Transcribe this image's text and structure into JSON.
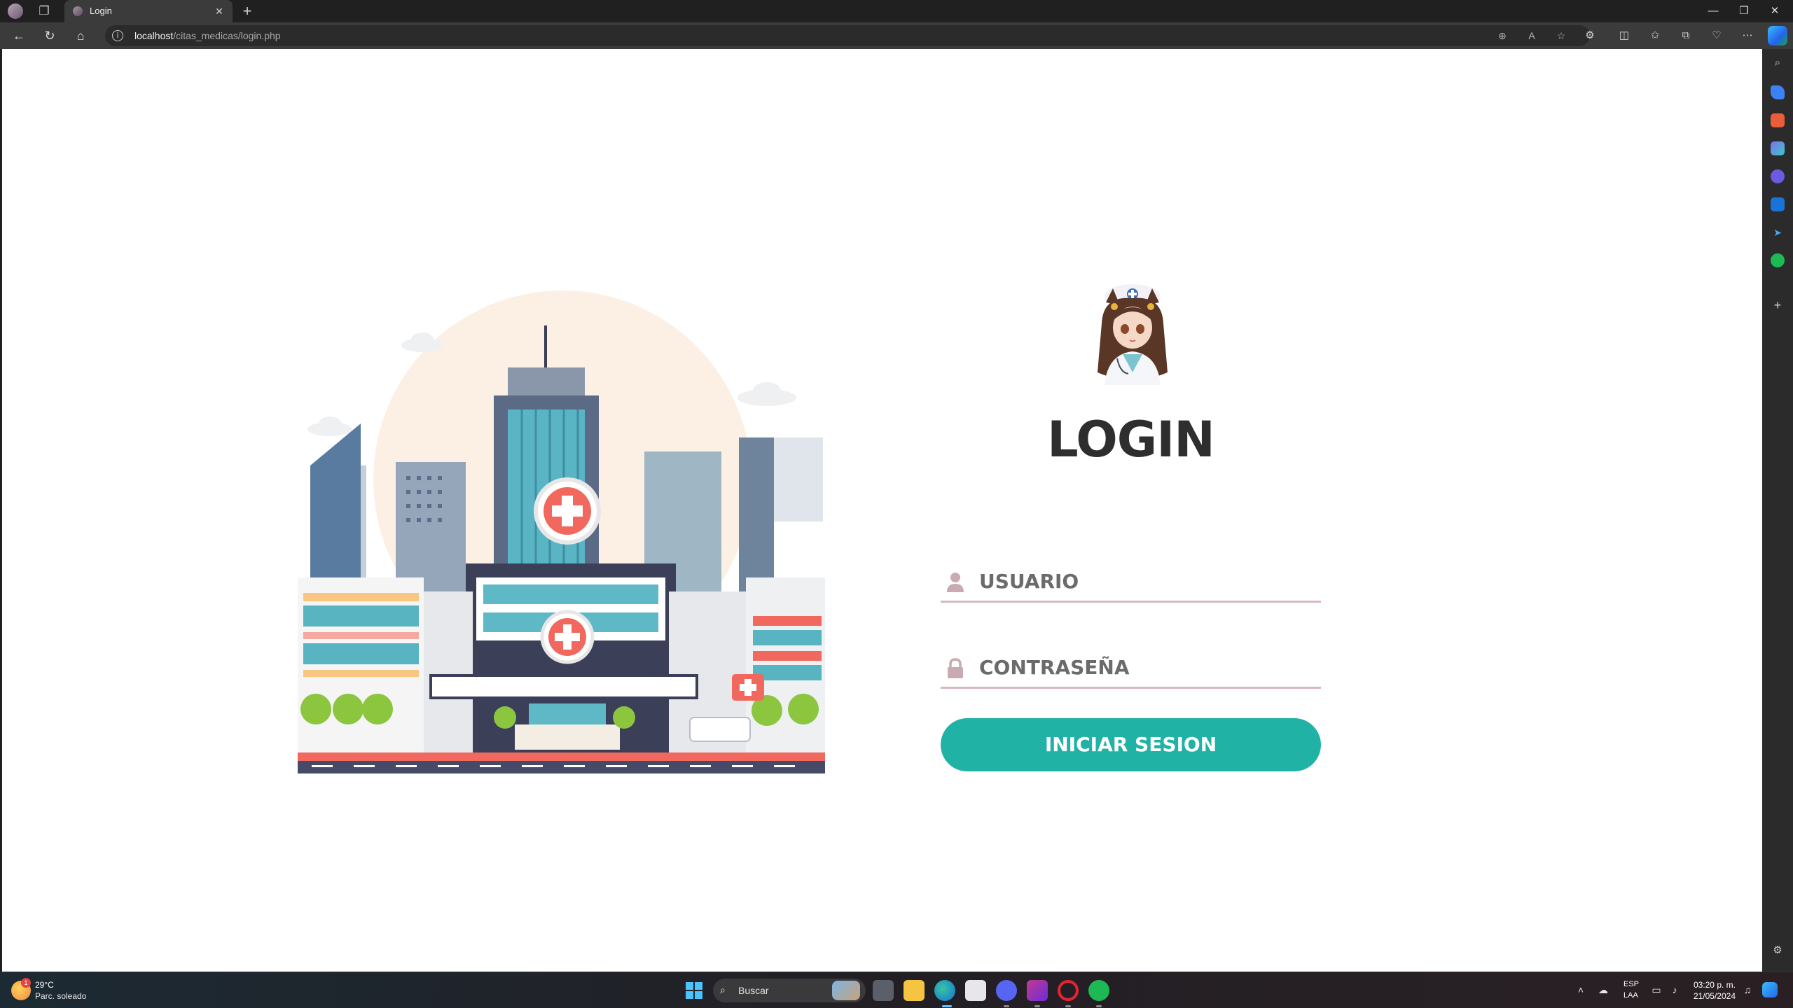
{
  "browser": {
    "tab_title": "Login",
    "tab_close": "✕",
    "new_tab": "+",
    "url_host": "localhost",
    "url_path": "/citas_medicas/login.php",
    "window_controls": [
      "—",
      "❐",
      "✕"
    ]
  },
  "login": {
    "title": "LOGIN",
    "username_placeholder": "USUARIO",
    "password_placeholder": "CONTRASEÑA",
    "submit_label": "INICIAR SESION"
  },
  "taskbar": {
    "weather_temp": "29°C",
    "weather_desc": "Parc. soleado",
    "weather_badge": "1",
    "search_placeholder": "Buscar",
    "lang_line1": "ESP",
    "lang_line2": "LAA",
    "clock_time": "03:20 p. m.",
    "clock_date": "21/05/2024"
  },
  "colors": {
    "accent_button": "#21b2a6",
    "field_underline": "#d8b8be",
    "icon_tint": "#c9aab0",
    "title_text": "#2e2e2e"
  }
}
